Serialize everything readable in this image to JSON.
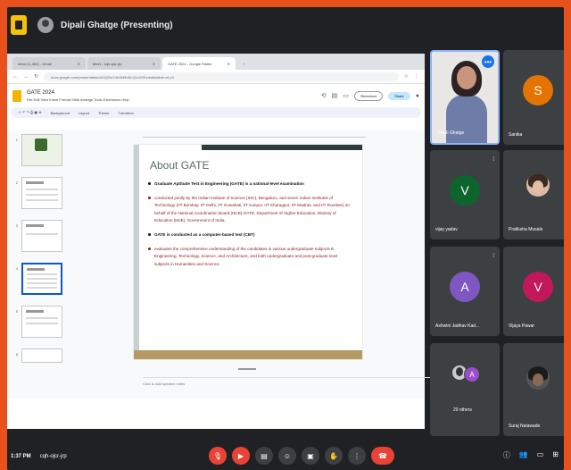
{
  "meeting": {
    "presenter_label": "Dipali Ghatge (Presenting)",
    "time": "1:37 PM",
    "code": "cqh-ojcr-jrp"
  },
  "browser": {
    "tabs": [
      {
        "label": "Inbox (1,462) - Gmail"
      },
      {
        "label": "Meet - cqh-ojcr-jrp"
      },
      {
        "label": "GATE 2024 - Google Slides"
      }
    ],
    "url": "docs.google.com/presentation/d/1Q2lwY4kGbRnNLQcv2GEz/edit#slide=id.p3"
  },
  "slides_app": {
    "doc_name": "GATE 2024",
    "menus": "File  Edit  View  Insert  Format  Slide  Arrange  Tools  Extensions  Help",
    "slideshow_label": "Slideshow",
    "share_label": "Share",
    "toolbar": [
      "Background",
      "Layout",
      "Theme",
      "Transition"
    ],
    "thumb_numbers": [
      "1",
      "2",
      "3",
      "4",
      "5",
      "6"
    ],
    "notes_placeholder": "Click to add speaker notes"
  },
  "slide": {
    "title": "About GATE",
    "bullets": [
      {
        "text": "Graduate Aptitude Test in Engineering (GATE) is a national-level examination",
        "style": "black"
      },
      {
        "text": "conducted jointly by the Indian Institute of Science (IISc), Bengaluru, and seven Indian Institutes of Technology (IIT Bombay, IIT Delhi, IIT Guwahati, IIT Kanpur, IIT Kharagpur, IIT Madras, and IIT Roorkee) on behalf of the National Coordination Board (NCB)-GATE, Department of Higher Education, Ministry of Education (MoE), Government of India.",
        "style": "red"
      },
      {
        "text": "GATE is conducted as a computer-based test (CBT)",
        "style": "black"
      },
      {
        "text": "evaluates the comprehensive understanding of the candidates in various undergraduate subjects in Engineering, Technology, Science, and Architecture, and both undergraduate and post-graduate level subjects in Humanities and Science.",
        "style": "red"
      }
    ]
  },
  "participants": [
    {
      "name": "Dipali Ghatge",
      "type": "photo"
    },
    {
      "name": "Sanika",
      "initial": "S",
      "color": "#e37400"
    },
    {
      "name": "vijay yadav",
      "initial": "V",
      "color": "#0d652d"
    },
    {
      "name": "Pratiksha Musale",
      "type": "round"
    },
    {
      "name": "Ashwini Jadhav Kad...",
      "initial": "A",
      "color": "#7e57c2"
    },
    {
      "name": "Vijaya Pawar",
      "initial": "V",
      "color": "#c2185b"
    },
    {
      "name": "20 others",
      "type": "others",
      "initial": "A"
    },
    {
      "name": "Suraj Nalawade",
      "type": "round-dark"
    }
  ],
  "colors": {
    "orange_frame": "#e8501c",
    "meet_bg": "#202124",
    "tile_bg": "#3c4043",
    "end_call": "#ea4335"
  }
}
